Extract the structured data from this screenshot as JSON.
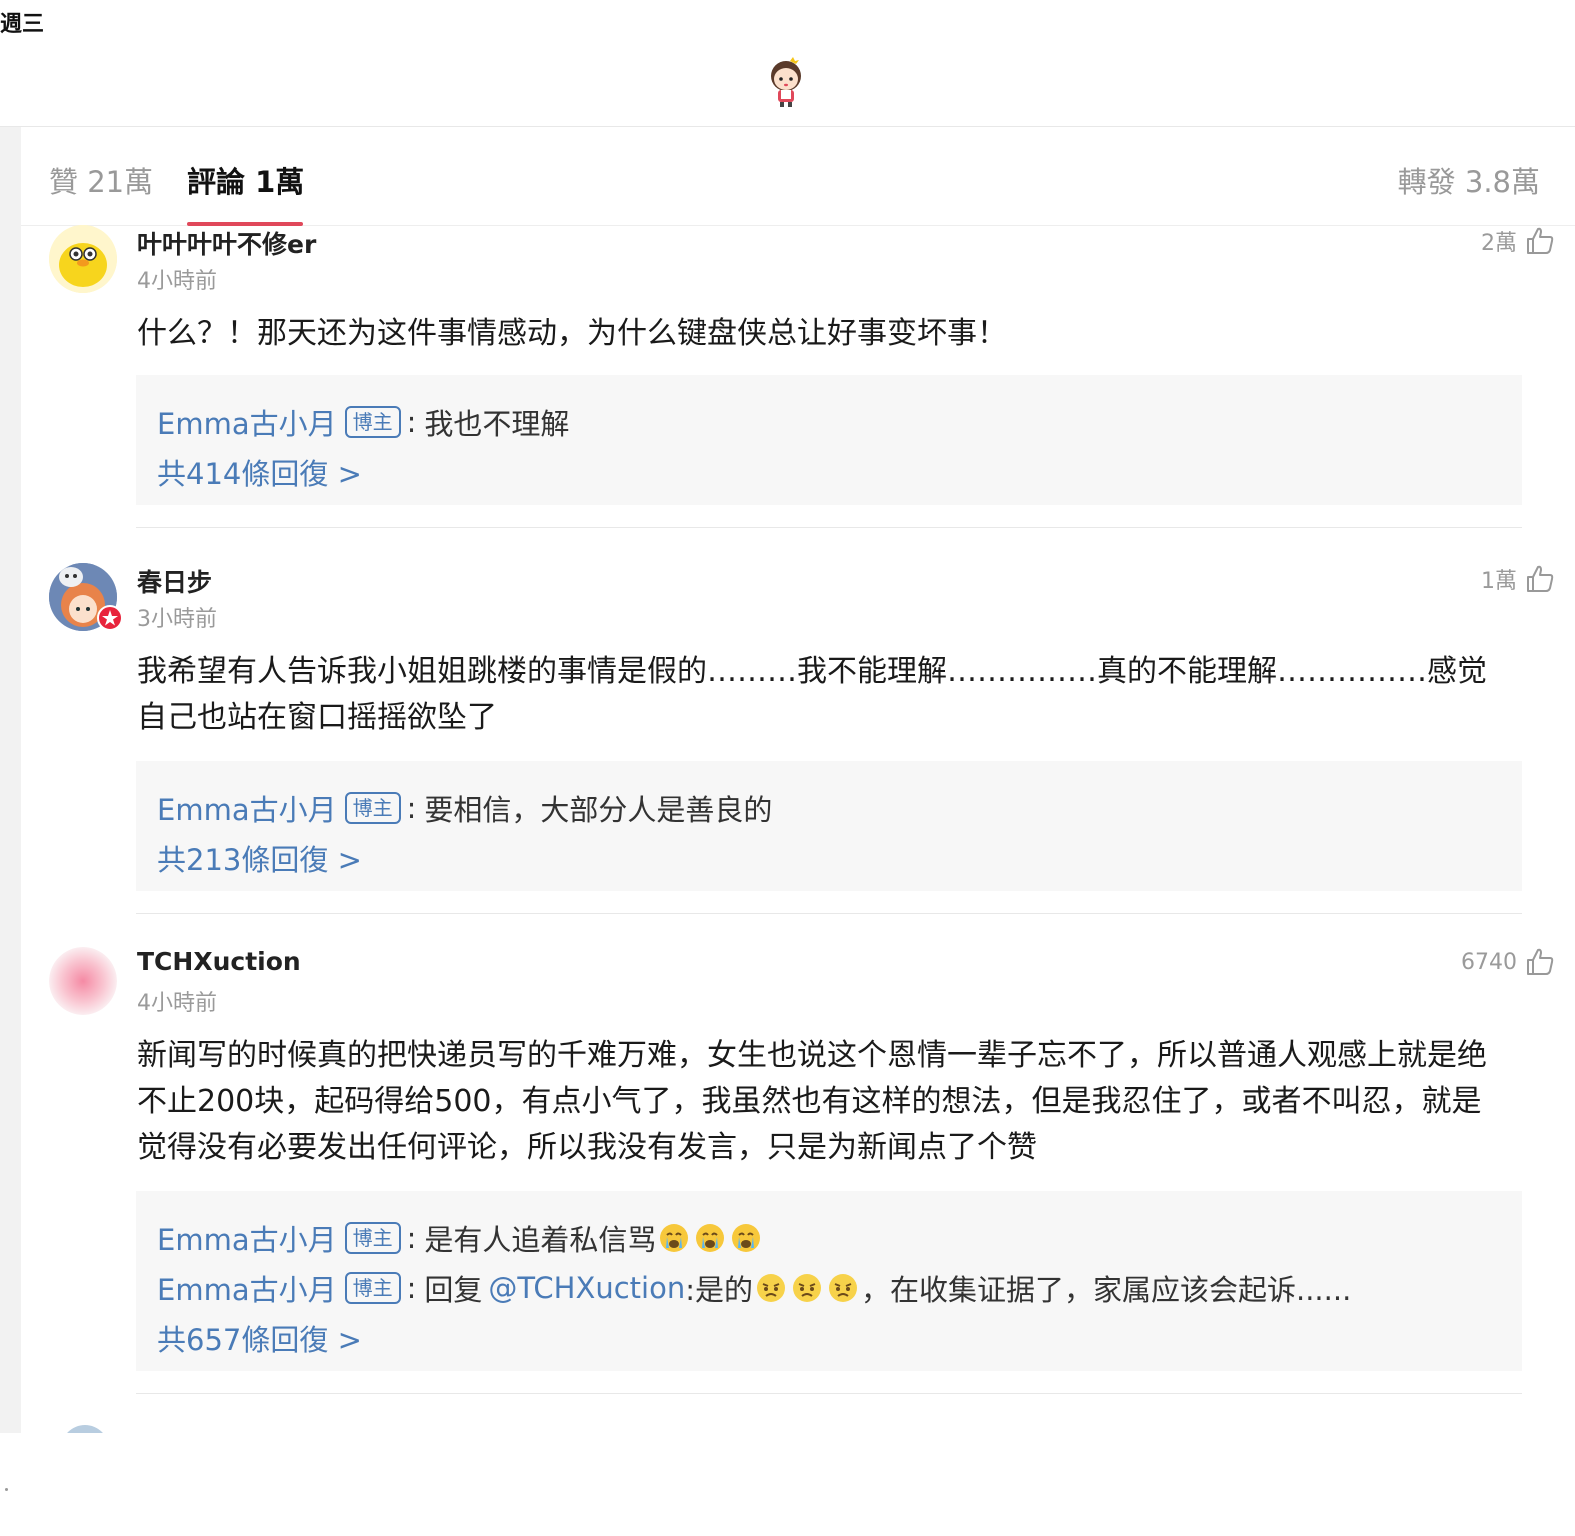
{
  "status": {
    "day": "週三"
  },
  "tabs": {
    "likes": "贊 21萬",
    "comments": "評論 1萬",
    "reposts": "轉發 3.8萬"
  },
  "colors": {
    "accent": "#e0485a",
    "link": "#4a7bb7"
  },
  "comments": [
    {
      "username": "叶叶叶叶不修er",
      "time": "4小時前",
      "likes": "2萬",
      "text": "什么？！那天还为这件事情感动，为什么键盘侠总让好事变坏事！",
      "replies": [
        {
          "author": "Emma古小月",
          "badge": "博主",
          "sep": ":",
          "text": "我也不理解"
        }
      ],
      "reply_count": "共414條回復 >"
    },
    {
      "username": "春日步",
      "time": "3小時前",
      "likes": "1萬",
      "text": "我希望有人告诉我小姐姐跳楼的事情是假的………我不能理解……………真的不能理解……………感觉自己也站在窗口摇摇欲坠了",
      "replies": [
        {
          "author": "Emma古小月",
          "badge": "博主",
          "sep": ":",
          "text": "要相信，大部分人是善良的"
        }
      ],
      "reply_count": "共213條回復 >"
    },
    {
      "username": "TCHXuction",
      "time": "4小時前",
      "likes": "6740",
      "text": "新闻写的时候真的把快递员写的千难万难，女生也说这个恩情一辈子忘不了，所以普通人观感上就是绝不止200块，起码得给500，有点小气了，我虽然也有这样的想法，但是我忍住了，或者不叫忍，就是觉得没有必要发出任何评论，所以我没有发言，只是为新闻点了个赞",
      "replies": [
        {
          "author": "Emma古小月",
          "badge": "博主",
          "sep": ":",
          "text": "是有人追着私信骂"
        },
        {
          "author": "Emma古小月",
          "badge": "博主",
          "sep": ":",
          "prefix": "回复",
          "mention": "@TCHXuction",
          "text": ":是的",
          "suffix": "，在收集证据了，家属应该会起诉......"
        }
      ],
      "reply_count": "共657條回復 >"
    }
  ]
}
